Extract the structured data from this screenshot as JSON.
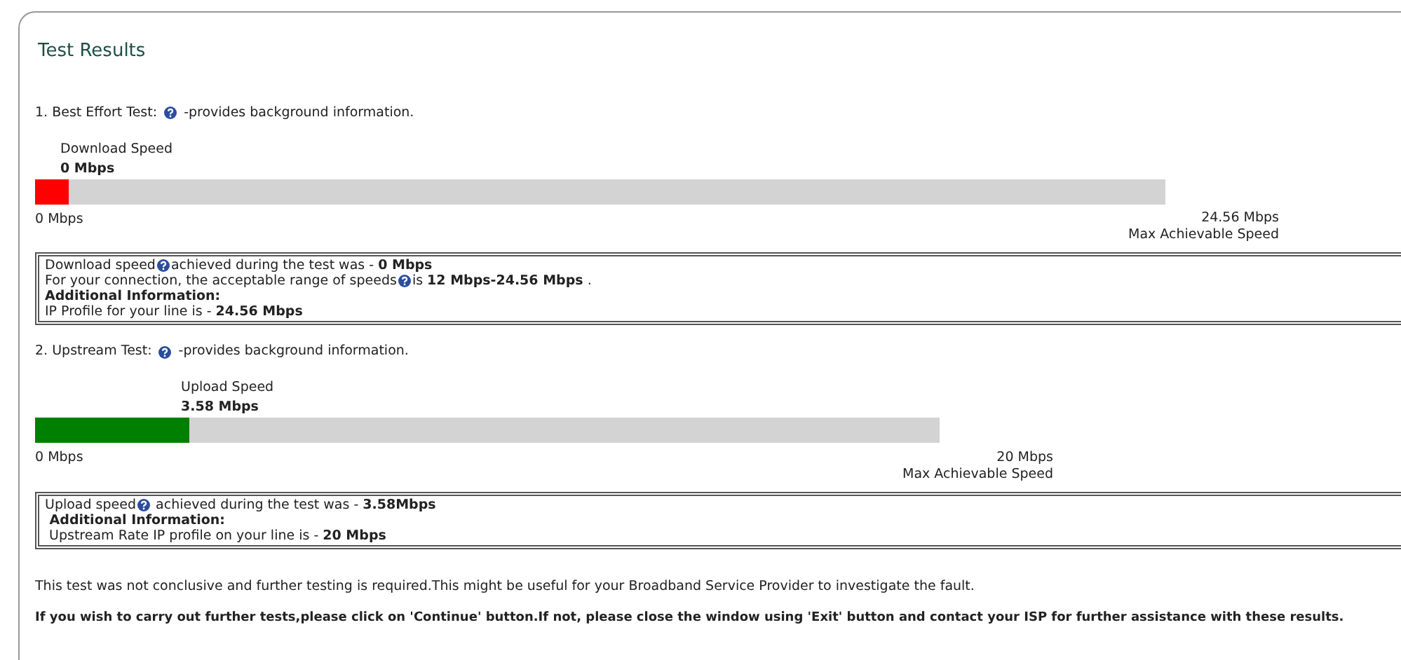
{
  "title": "Test Results",
  "tests": [
    {
      "heading": "1. Best Effort Test:",
      "heading_note": "-provides background information.",
      "label": "Download Speed",
      "value": "0 Mbps",
      "level": 0.03,
      "color": "#ff0000",
      "min": "0 Mbps",
      "max": "24.56 Mbps",
      "max_caption": "Max Achievable Speed",
      "info": [
        [
          {
            "kind": "text",
            "text": "Download speed"
          },
          {
            "kind": "help"
          },
          {
            "kind": "text",
            "text": "achieved during the test was - **0 Mbps**"
          }
        ],
        [
          {
            "kind": "text",
            "text": "For your connection, the acceptable range of speeds"
          },
          {
            "kind": "help"
          },
          {
            "kind": "text",
            "text": "is **12 Mbps-24.56 Mbps** ."
          }
        ],
        [
          {
            "kind": "heading",
            "text": "Additional Information:"
          }
        ],
        [
          {
            "kind": "text",
            "text": "IP Profile for your line is - **24.56 Mbps**"
          }
        ]
      ]
    },
    {
      "heading": "2. Upstream Test:",
      "heading_note": "-provides background information.",
      "label": "Upload Speed",
      "value": "3.58 Mbps",
      "level": 0.17,
      "color": "#008000",
      "min": "0 Mbps",
      "max": "20 Mbps",
      "max_caption": "Max Achievable Speed",
      "info": [
        [
          {
            "kind": "text",
            "text": "Upload speed"
          },
          {
            "kind": "help"
          },
          {
            "kind": "text",
            "text": " achieved during the test was - **3.58Mbps**"
          }
        ],
        [
          {
            "kind": "heading",
            "text": " Additional Information:"
          }
        ],
        [
          {
            "kind": "text",
            "text": " Upstream Rate IP profile on your line is - **20 Mbps**"
          }
        ]
      ]
    }
  ],
  "note": "This test was not conclusive and further testing is required.This might be useful for your Broadband Service Provider to investigate the fault.",
  "instruction": "If you wish to carry out further tests,please click on 'Continue' button.If not, please close the window using 'Exit' button and contact your ISP for further assistance with these results."
}
